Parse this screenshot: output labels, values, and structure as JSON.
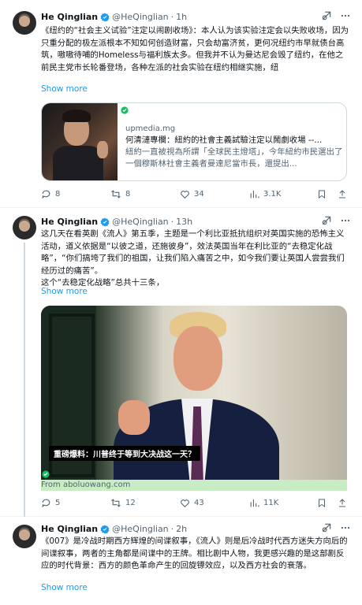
{
  "tweets": [
    {
      "author": "He Qinglian",
      "handle": "@HeQinglian",
      "dot": "·",
      "time": "1h",
      "text": "《纽约的“社会主义试验”注定以闹剧收场》：本人认为该实验注定会以失败收场，因为只重分配的极左派根本不知如何创造财富，只会劫富济贫，更何况纽约市早就债台高筑，嗷嗷待哺的Homeless与福利族太多。但我并不认为曼达尼会毁了纽约，在他之前民主党市长轮番登场，各种左派的社会实验在纽约相继实施，纽",
      "show_more": "Show more",
      "card": {
        "domain": "upmedia.mg",
        "title": "何清漣專欄：紐約的社會主義試驗注定以鬧劇收場 --...",
        "description": "紐約一直被視為所謂「全球民主燈塔」，今年紐約市民選出了一個穆斯林社會主義者曼達尼當市長，還提出..."
      },
      "stats": {
        "replies": "8",
        "reposts": "8",
        "likes": "34",
        "views": "3.1K"
      }
    },
    {
      "author": "He Qinglian",
      "handle": "@HeQinglian",
      "dot": "·",
      "time": "13h",
      "text": "这几天在看英剧《流人》第五季，主题是一个利比亚抵抗组织对英国实施的恐怖主义活动，道义依据是“以彼之道，还施彼身”，效法英国当年在利比亚的“去稳定化战略”，“你们搞垮了我们的祖国，让我们陷入痛苦之中，如今我们要让英国人尝尝我们经历过的痛苦”。\n这个“去稳定化战略”总共十三条，",
      "show_more": "Show more",
      "media_caption": "重磅爆料：川普终于等到大决战这一天？",
      "media_source": "From aboluowang.com",
      "stats": {
        "replies": "5",
        "reposts": "12",
        "likes": "43",
        "views": "11K"
      }
    },
    {
      "author": "He Qinglian",
      "handle": "@HeQinglian",
      "dot": "·",
      "time": "2h",
      "text": "《007》是冷战时期西方辉煌的间谍叙事，《流人》则是后冷战时代西方迷失方向后的间谍叙事，两者的主角都是间谍中的王牌。相比剧中人物，我更感兴趣的是这部剧反应的时代背景：西方的颜色革命产生的回旋镖效应，以及西方社会的衰落。",
      "show_more": "Show more"
    }
  ],
  "colors": {
    "accent": "#1d9bf0",
    "verified": "#1d9bf0",
    "muted": "#536471"
  },
  "icons": [
    "verified-badge-icon",
    "grok-icon",
    "more-icon",
    "reply-icon",
    "repost-icon",
    "like-icon",
    "views-icon",
    "bookmark-icon",
    "share-icon",
    "check-circle-icon"
  ]
}
